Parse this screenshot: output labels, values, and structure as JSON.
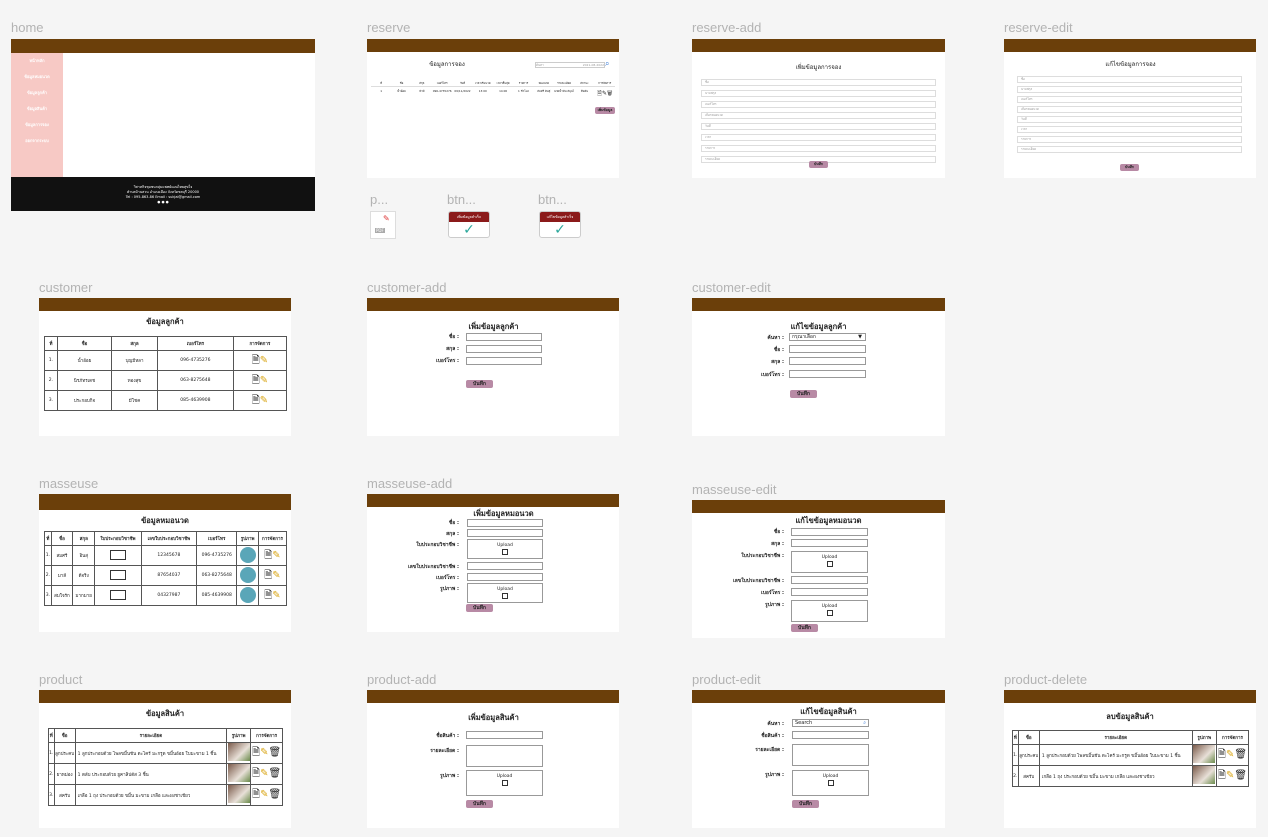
{
  "frames": {
    "home": "home",
    "reserve": "reserve",
    "reserve_add": "reserve-add",
    "reserve_edit": "reserve-edit",
    "p": "p...",
    "btn1": "btn...",
    "btn2": "btn...",
    "customer": "customer",
    "customer_add": "customer-add",
    "customer_edit": "customer-edit",
    "masseuse": "masseuse",
    "masseuse_add": "masseuse-add",
    "masseuse_edit": "masseuse-edit",
    "product": "product",
    "product_add": "product-add",
    "product_edit": "product-edit",
    "product_delete": "product-delete"
  },
  "home": {
    "menu": [
      "หน้าหลัก",
      "ข้อมูลหมอนวด",
      "ข้อมูลลูกค้า",
      "ข้อมูลสินค้า",
      "ข้อมูลการจอง",
      "ออกจากระบบ"
    ],
    "footer1": "วิสาหกิจชุมชนกลุ่มแพทย์แผนไทยสุขใจ",
    "footer2": "ตำบลบ้านสวน อำเภอเมือง จังหวัดชลบุรี 20000",
    "footer3": "Tel : 095-863-86 Email : sukjai@gmail.com"
  },
  "reserve": {
    "title": "ข้อมูลการจอง",
    "search": "ค้นหา",
    "date": "2021-08-2022",
    "cols": [
      "ที่",
      "ชื่อ",
      "สกุล",
      "เบอร์โทร",
      "วันที่",
      "เวลาเริ่มนวด",
      "เวลาสิ้นสุด",
      "รายการ",
      "หมอนวด",
      "รายละเอียด",
      "สถานะ",
      "การจัดการ"
    ],
    "row": [
      "1",
      "น้ำอ้อย",
      "บัวมี",
      "096-4735276",
      "09/11/2022",
      "13:00",
      "14:00",
      "1 ชั่วโมง",
      "สมศรี อินสุ",
      "นวดน้ำมัน สมุนไพรนวดประคบ",
      "ยืนยัน"
    ],
    "add": "เพิ่มข้อมูล"
  },
  "reserve_add": {
    "title": "เพิ่มข้อมูลการจอง",
    "fields": [
      "ชื่อ",
      "นามสกุล",
      "เบอร์โทร",
      "เลือกหมอนวด",
      "วันที่",
      "เวลา",
      "รายการ",
      "รายละเอียด"
    ],
    "save": "บันทึก"
  },
  "reserve_edit": {
    "title": "แก้ไขข้อมูลการจอง",
    "fields": [
      "ชื่อ",
      "นามสกุล",
      "เบอร์โทร",
      "เลือกหมอนวด",
      "วันที่",
      "เวลา",
      "รายการ",
      "รายละเอียด"
    ],
    "save": "บันทึก"
  },
  "btns": {
    "add_ok": "เพิ่มข้อมูลสำเร็จ",
    "edit_ok": "แก้ไขข้อมูลสำเร็จ",
    "pdf": "PDF"
  },
  "customer": {
    "title": "ข้อมูลลูกค้า",
    "cols": [
      "ที่",
      "ชื่อ",
      "สกุล",
      "เบอร์โทร",
      "การจัดการ"
    ],
    "rows": [
      [
        "1.",
        "น้ำอ้อย",
        "บุญมีหลา",
        "096-4735276"
      ],
      [
        "2.",
        "นิรภัทรเดช",
        "ทองสุข",
        "063-8275648"
      ],
      [
        "3.",
        "ประกอบกิจ",
        "มีโชค",
        "085-4639908"
      ]
    ]
  },
  "customer_add": {
    "title": "เพิ่มข้อมูลลูกค้า",
    "fname": "ชื่อ :",
    "lname": "สกุล :",
    "tel": "เบอร์โทร :",
    "save": "บันทึก"
  },
  "customer_edit": {
    "title": "แก้ไขข้อมูลลูกค้า",
    "search": "ค้นหา :",
    "select": "กรุณาเลือก",
    "fname": "ชื่อ :",
    "lname": "สกุล :",
    "tel": "เบอร์โทร :",
    "save": "บันทึก"
  },
  "masseuse": {
    "title": "ข้อมูลหมอนวด",
    "cols": [
      "ที่",
      "ชื่อ",
      "สกุล",
      "ใบประกอบวิชาชีพ",
      "เลขใบประกอบวิชาชีพ",
      "เบอร์โทร",
      "รูปภาพ",
      "การจัดการ"
    ],
    "rows": [
      [
        "1.",
        "สมศรี",
        "อินสุ",
        "12345678",
        "096-4735276"
      ],
      [
        "2.",
        "มาลี",
        "ดีจริง",
        "87654037",
        "063-8275648"
      ],
      [
        "3.",
        "สมใจรัก",
        "มากมาย",
        "04327987",
        "085-4639908"
      ]
    ]
  },
  "masseuse_add": {
    "title": "เพิ่มข้อมูลหมอนวด",
    "fname": "ชื่อ :",
    "lname": "สกุล :",
    "license": "ใบประกอบวิชาชีพ :",
    "license_no": "เลขใบประกอบวิชาชีพ :",
    "tel": "เบอร์โทร :",
    "photo": "รูปภาพ :",
    "upload": "Upload",
    "save": "บันทึก"
  },
  "masseuse_edit": {
    "title": "แก้ไขข้อมูลหมอนวด",
    "fname": "ชื่อ :",
    "lname": "สกุล :",
    "license": "ใบประกอบวิชาชีพ :",
    "license_no": "เลขใบประกอบวิชาชีพ :",
    "tel": "เบอร์โทร :",
    "photo": "รูปภาพ :",
    "upload": "Upload",
    "save": "บันทึก"
  },
  "product": {
    "title": "ข้อมูลสินค้า",
    "cols": [
      "ที่",
      "ชื่อ",
      "รายละเอียด",
      "รูปภาพ",
      "การจัดการ"
    ],
    "rows": [
      [
        "1.",
        "ลูกประคบ",
        "1 ลูกประกอบด้วย ไพลขมิ้นชัน ตะไคร้ มะกรูด ขมิ้นอ้อย ใบมะขาม 1 ชิ้น"
      ],
      [
        "2.",
        "ยาหม่อง",
        "1 ตลับ ประกอบด้วย ยูคาลิปตัส 3 ชิ้น"
      ],
      [
        "3.",
        "สครับ",
        "เกลือ 1 ถุง ประกอบด้วย ขมิ้น มะขาม เกลือ และผงชาเขียว"
      ]
    ]
  },
  "product_add": {
    "title": "เพิ่มข้อมูลสินค้า",
    "name": "ชื่อสินค้า :",
    "detail": "รายละเอียด :",
    "photo": "รูปภาพ :",
    "upload": "Upload",
    "save": "บันทึก"
  },
  "product_edit": {
    "title": "แก้ไขข้อมูลสินค้า",
    "search": "ค้นหา :",
    "search_ph": "Search",
    "name": "ชื่อสินค้า :",
    "detail": "รายละเอียด :",
    "photo": "รูปภาพ :",
    "upload": "Upload",
    "save": "บันทึก"
  },
  "product_delete": {
    "title": "ลบข้อมูลสินค้า",
    "cols": [
      "ที่",
      "ชื่อ",
      "รายละเอียด",
      "รูปภาพ",
      "การจัดการ"
    ],
    "rows": [
      [
        "1.",
        "ลูกประคบ",
        "1 ลูกประกอบด้วย ไพลขมิ้นชัน ตะไคร้ มะกรูด ขมิ้นอ้อย ใบมะขาม 1 ชิ้น"
      ],
      [
        "2.",
        "สครับ",
        "เกลือ 1 ถุง ประกอบด้วย ขมิ้น มะขาม เกลือ และผงชาเขียว"
      ]
    ]
  }
}
